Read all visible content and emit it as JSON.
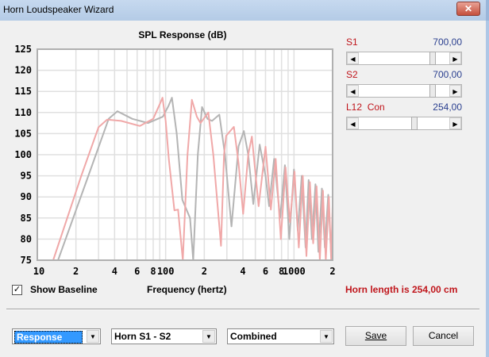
{
  "window": {
    "title": "Horn Loudspeaker Wizard",
    "close_glyph": "✕"
  },
  "sliders": [
    {
      "label": "S1",
      "value": "700,00",
      "position": 0.84
    },
    {
      "label": "S2",
      "value": "700,00",
      "position": 0.84
    },
    {
      "label": "L12  Con",
      "value": "254,00",
      "position": 0.62
    }
  ],
  "show_baseline": {
    "label": "Show Baseline",
    "checked": true
  },
  "status": {
    "text": "Horn length is 254,00 cm",
    "color": "#c0161c"
  },
  "bottom": {
    "view_select": "Response",
    "horn_select": "Horn S1 - S2",
    "mode_select": "Combined",
    "save": "Save",
    "cancel": "Cancel"
  },
  "chart_data": {
    "type": "line",
    "title": "SPL Response (dB)",
    "xlabel": "Frequency (hertz)",
    "ylabel": "",
    "xscale": "log",
    "xlim": [
      10,
      2000
    ],
    "ylim": [
      75,
      125
    ],
    "yticks": [
      75,
      80,
      85,
      90,
      95,
      100,
      105,
      110,
      115,
      120,
      125
    ],
    "xticks": [
      {
        "v": 10,
        "t": "10"
      },
      {
        "v": 20,
        "t": "2"
      },
      {
        "v": 40,
        "t": "4"
      },
      {
        "v": 60,
        "t": "6"
      },
      {
        "v": 80,
        "t": "8"
      },
      {
        "v": 100,
        "t": "100"
      },
      {
        "v": 200,
        "t": "2"
      },
      {
        "v": 400,
        "t": "4"
      },
      {
        "v": 600,
        "t": "6"
      },
      {
        "v": 800,
        "t": "8"
      },
      {
        "v": 1000,
        "t": "1000"
      },
      {
        "v": 2000,
        "t": "2"
      }
    ],
    "grid": true,
    "series": [
      {
        "name": "Baseline",
        "color": "#b4b4b4",
        "points": [
          [
            14.5,
            75
          ],
          [
            25,
            95
          ],
          [
            36,
            108.5
          ],
          [
            42,
            110.3
          ],
          [
            55,
            108.5
          ],
          [
            73,
            107.5
          ],
          [
            95,
            109
          ],
          [
            105,
            111.5
          ],
          [
            112,
            113.5
          ],
          [
            122,
            105
          ],
          [
            135,
            89.3
          ],
          [
            155,
            85
          ],
          [
            164,
            75
          ],
          [
            178,
            100
          ],
          [
            192,
            111.3
          ],
          [
            212,
            108.5
          ],
          [
            230,
            108
          ],
          [
            262,
            109.5
          ],
          [
            290,
            100
          ],
          [
            326,
            83
          ],
          [
            370,
            102
          ],
          [
            407,
            105.6
          ],
          [
            440,
            100
          ],
          [
            482,
            88.3
          ],
          [
            540,
            102.4
          ],
          [
            600,
            95
          ],
          [
            640,
            87.8
          ],
          [
            700,
            99
          ],
          [
            780,
            85
          ],
          [
            850,
            97.5
          ],
          [
            920,
            80
          ],
          [
            1000,
            96.5
          ],
          [
            1070,
            82
          ],
          [
            1150,
            95
          ],
          [
            1230,
            78
          ],
          [
            1300,
            94
          ],
          [
            1380,
            80
          ],
          [
            1470,
            93
          ],
          [
            1550,
            77
          ],
          [
            1650,
            92
          ],
          [
            1740,
            78
          ],
          [
            1850,
            90.5
          ],
          [
            1950,
            76
          ],
          [
            2000,
            85
          ]
        ]
      },
      {
        "name": "Combined",
        "color": "#f0a8a8",
        "points": [
          [
            13.3,
            75
          ],
          [
            22,
            95
          ],
          [
            30,
            106.5
          ],
          [
            35,
            108.3
          ],
          [
            45,
            108
          ],
          [
            63,
            106.8
          ],
          [
            80,
            108.5
          ],
          [
            90,
            112
          ],
          [
            94.5,
            113.5
          ],
          [
            100,
            108
          ],
          [
            106,
            98.7
          ],
          [
            117,
            86.8
          ],
          [
            125,
            87
          ],
          [
            136,
            75
          ],
          [
            148,
            100
          ],
          [
            160,
            113
          ],
          [
            175,
            109
          ],
          [
            187,
            107.5
          ],
          [
            215,
            110
          ],
          [
            235,
            100
          ],
          [
            270,
            78.4
          ],
          [
            285,
            100
          ],
          [
            296,
            104.5
          ],
          [
            340,
            106.6
          ],
          [
            370,
            98
          ],
          [
            402,
            86
          ],
          [
            440,
            100
          ],
          [
            470,
            104.3
          ],
          [
            530,
            87.8
          ],
          [
            600,
            101.9
          ],
          [
            660,
            87
          ],
          [
            720,
            99
          ],
          [
            790,
            80
          ],
          [
            860,
            97
          ],
          [
            930,
            84
          ],
          [
            1010,
            96
          ],
          [
            1090,
            78
          ],
          [
            1170,
            95
          ],
          [
            1250,
            76
          ],
          [
            1330,
            93.5
          ],
          [
            1410,
            79
          ],
          [
            1500,
            92.5
          ],
          [
            1590,
            75
          ],
          [
            1680,
            91.5
          ],
          [
            1770,
            75
          ],
          [
            1870,
            90
          ],
          [
            1950,
            75
          ],
          [
            2000,
            88
          ]
        ]
      }
    ]
  }
}
